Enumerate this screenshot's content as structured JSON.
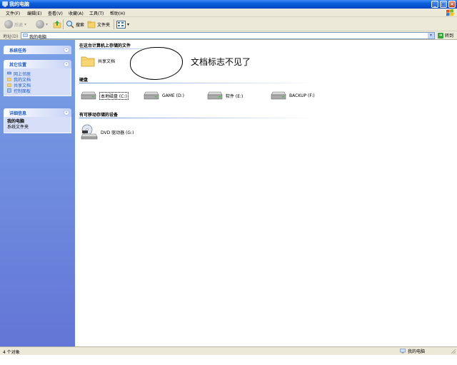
{
  "window": {
    "title": "我的电脑",
    "buttons": {
      "minimize": "_",
      "maximize": "□",
      "close": "×"
    }
  },
  "menu": [
    "文件(F)",
    "编辑(E)",
    "查看(V)",
    "收藏(A)",
    "工具(T)",
    "帮助(H)"
  ],
  "toolbar": {
    "back_label": "后退",
    "search_label": "搜索",
    "folders_label": "文件夹"
  },
  "address": {
    "label": "地址(D)",
    "value": "我的电脑",
    "go_label": "转到"
  },
  "sidebar": {
    "system_tasks": {
      "title": "系统任务"
    },
    "other_places": {
      "title": "其它位置",
      "items": [
        {
          "label": "网上邻居",
          "icon": "network-icon"
        },
        {
          "label": "我的文档",
          "icon": "folder-icon"
        },
        {
          "label": "共享文档",
          "icon": "folder-icon"
        },
        {
          "label": "控制面板",
          "icon": "control-panel-icon"
        }
      ]
    },
    "details": {
      "title": "详细信息",
      "name": "我的电脑",
      "type": "系统文件夹"
    }
  },
  "main": {
    "sections": [
      {
        "title": "在这台计算机上存储的文件"
      },
      {
        "title": "硬盘"
      },
      {
        "title": "有可移动存储的设备"
      }
    ],
    "shared_folder": "共享文档",
    "annotation": "文档标志不见了",
    "drives": [
      {
        "label": "本地磁盘 (C:)",
        "selected": true
      },
      {
        "label": "GAME (D:)",
        "selected": false
      },
      {
        "label": "软件 (E:)",
        "selected": false
      },
      {
        "label": "BACKUP (F:)",
        "selected": false
      }
    ],
    "removable": [
      {
        "label": "DVD 驱动器 (G:)"
      }
    ]
  },
  "status": {
    "left": "4 个对象",
    "right": "我的电脑"
  }
}
